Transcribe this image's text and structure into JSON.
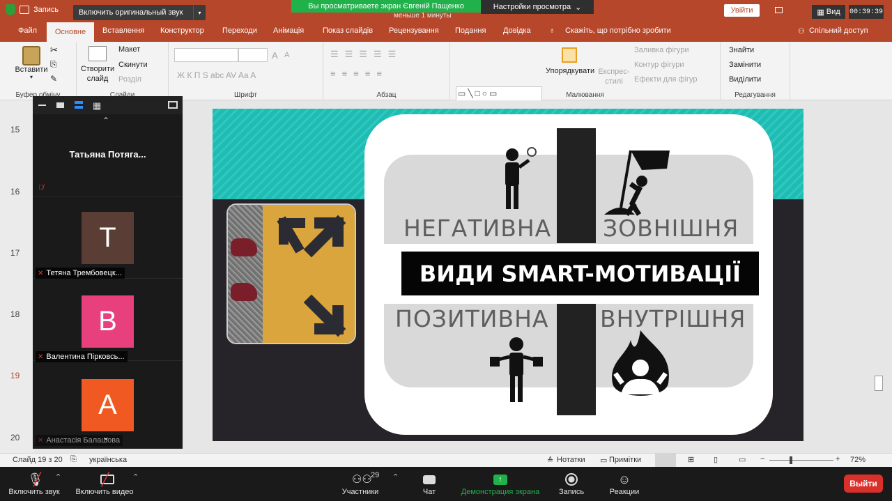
{
  "zoom_top": {
    "recording_label": "Запись",
    "original_sound_button": "Включить оригинальный звук",
    "share_banner": "Вы просматриваете экран Євгеній Пащенко",
    "banner_sub": "меньше 1 минуты",
    "view_options": "Настройки просмотра",
    "view_button": "Вид",
    "timer": "00:39:39"
  },
  "ppt": {
    "signin_button": "Увійти",
    "menu": [
      "Файл",
      "Основне",
      "Вставлення",
      "Конструктор",
      "Переходи",
      "Анімація",
      "Показ слайдів",
      "Рецензування",
      "Подання",
      "Довідка"
    ],
    "tell_me": "Скажіть, що потрібно зробити",
    "share": "Спільний доступ",
    "ribbon": {
      "paste": "Вставити",
      "clipboard_group": "Буфер обміну",
      "new_slide": "Створити слайд",
      "layout": "Макет",
      "reset": "Скинути",
      "section": "Розділ",
      "slides_group": "Слайди",
      "font_group": "Шрифт",
      "font_letters": "Ж  К  П  Ѕ  abc  AV  Aa  A",
      "font_size_up": "A",
      "font_size_down": "A",
      "paragraph_group": "Абзац",
      "arrange": "Упорядкувати",
      "quick_styles": "Експрес-стилі",
      "shape_fill": "Заливка фігури",
      "shape_outline": "Контур фігури",
      "shape_effects": "Ефекти для фігур",
      "drawing_group": "Малювання",
      "find": "Знайти",
      "replace": "Замінити",
      "select": "Виділити",
      "editing_group": "Редагування"
    },
    "slide_numbers": [
      "15",
      "16",
      "17",
      "18",
      "19",
      "20"
    ],
    "slide": {
      "title": "ВИДИ SMART-МОТИВАЦІЇ",
      "q_negative": "НЕГАТИВНА",
      "q_external": "ЗОВНІШНЯ",
      "q_positive": "ПОЗИТИВНА",
      "q_internal": "ВНУТРІШНЯ"
    },
    "status": {
      "slide_of": "Слайд 19 з 20",
      "language": "українська",
      "notes": "Нотатки",
      "comments": "Примітки",
      "zoom": "72%"
    }
  },
  "participants_panel": {
    "tiles": [
      {
        "name": "Татьяна  Потяга...",
        "initial": "",
        "color": ""
      },
      {
        "name": "Тетяна Трембовецк...",
        "initial": "T",
        "color": "#5a3e36"
      },
      {
        "name": "Валентина Пірковсь...",
        "initial": "B",
        "color": "#e8407c"
      },
      {
        "name": "Анастасія Балашова",
        "initial": "A",
        "color": "#f05a22"
      }
    ]
  },
  "zoom_bottom": {
    "unmute": "Включить звук",
    "start_video": "Включить видео",
    "participants": "Участники",
    "participants_count": "29",
    "chat": "Чат",
    "share_screen": "Демонстрация экрана",
    "record": "Запись",
    "reactions": "Реакции",
    "leave": "Выйти"
  }
}
